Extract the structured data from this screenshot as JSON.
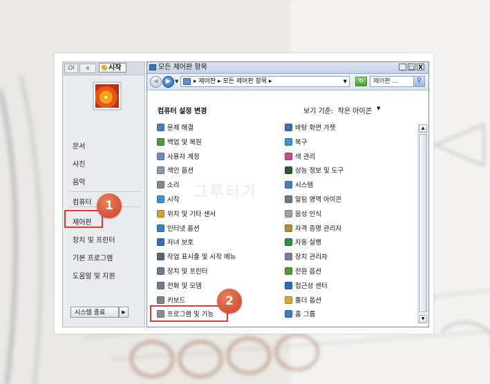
{
  "start_menu": {
    "start_label": "시작",
    "tb_btn1": "Ol",
    "tb_btn2": "x",
    "items": [
      "문서",
      "사진",
      "음악",
      "컴퓨터",
      "제어판",
      "장치 및 프린터",
      "기본 프로그램",
      "도움말 및 지원"
    ],
    "shutdown_label": "시스템 종료",
    "shutdown_arrow": "▶"
  },
  "window": {
    "title": "모든 제어판 항목",
    "btn_min": "_",
    "btn_max": "□",
    "btn_close": "X",
    "address": "▸ 제어판 ▸ 모든 제어판 항목 ▸",
    "address_dropdown": "▼",
    "search_placeholder": "제어판 ...",
    "search_icon_glyph": "⚲",
    "heading": "컴퓨터 설정 변경",
    "view_by_label": "보기 기준:",
    "view_by_value": "작은 아이콘",
    "view_by_dropdown": "▼",
    "back_glyph": "◀",
    "forward_glyph": "▶",
    "nav_dropdown": "▼",
    "refresh_glyph": "↻",
    "scroll_up": "▲",
    "scroll_down": "▼"
  },
  "items_left": [
    {
      "label": "문제 해결",
      "icon": "troubleshoot-icon",
      "color": "#4a7fc1"
    },
    {
      "label": "백업 및 복원",
      "icon": "backup-icon",
      "color": "#4f9a3a"
    },
    {
      "label": "사용자 계정",
      "icon": "user-accounts-icon",
      "color": "#6b8fbf"
    },
    {
      "label": "색인 옵션",
      "icon": "indexing-icon",
      "color": "#8a99ad"
    },
    {
      "label": "소리",
      "icon": "sound-icon",
      "color": "#7f8894"
    },
    {
      "label": "시작",
      "icon": "getting-started-icon",
      "color": "#3e8fd6"
    },
    {
      "label": "위치 및 기타 센서",
      "icon": "location-sensor-icon",
      "color": "#caa53a"
    },
    {
      "label": "인터넷 옵션",
      "icon": "internet-options-icon",
      "color": "#2f86c9"
    },
    {
      "label": "자녀 보호",
      "icon": "parental-controls-icon",
      "color": "#3b6fb5"
    },
    {
      "label": "작업 표시줄 및 시작 메뉴",
      "icon": "taskbar-icon",
      "color": "#5a6778"
    },
    {
      "label": "장치 및 프린터",
      "icon": "devices-printers-icon",
      "color": "#6e7b8a"
    },
    {
      "label": "전화 및 모뎀",
      "icon": "phone-modem-icon",
      "color": "#6f7d8e"
    },
    {
      "label": "키보드",
      "icon": "keyboard-icon",
      "color": "#7d858e"
    },
    {
      "label": "프로그램 및 기능",
      "icon": "programs-features-icon",
      "color": "#8a8f96"
    }
  ],
  "items_right": [
    {
      "label": "바탕 화면 가젯",
      "icon": "desktop-gadgets-icon",
      "color": "#3f6fb0"
    },
    {
      "label": "복구",
      "icon": "recovery-icon",
      "color": "#3c93d4"
    },
    {
      "label": "색 관리",
      "icon": "color-management-icon",
      "color": "#c24f8a"
    },
    {
      "label": "성능 정보 및 도구",
      "icon": "performance-icon",
      "color": "#2e5a32"
    },
    {
      "label": "시스템",
      "icon": "system-icon",
      "color": "#4a7db8"
    },
    {
      "label": "알림 영역 아이콘",
      "icon": "notification-area-icon",
      "color": "#6c7a8b"
    },
    {
      "label": "음성 인식",
      "icon": "speech-recognition-icon",
      "color": "#9aa3ad"
    },
    {
      "label": "자격 증명 관리자",
      "icon": "credential-manager-icon",
      "color": "#b98b3a"
    },
    {
      "label": "자동 실행",
      "icon": "autoplay-icon",
      "color": "#2f8f47"
    },
    {
      "label": "장치 관리자",
      "icon": "device-manager-icon",
      "color": "#7b8390"
    },
    {
      "label": "전원 옵션",
      "icon": "power-options-icon",
      "color": "#4f9a3a"
    },
    {
      "label": "접근성 센터",
      "icon": "ease-of-access-icon",
      "color": "#2b6cc2"
    },
    {
      "label": "폴더 옵션",
      "icon": "folder-options-icon",
      "color": "#d9a92a"
    },
    {
      "label": "홈 그룹",
      "icon": "homegroup-icon",
      "color": "#3a7fc7"
    }
  ],
  "annotations": {
    "badge1": "1",
    "badge2": "2",
    "accent": "#e0382b"
  }
}
